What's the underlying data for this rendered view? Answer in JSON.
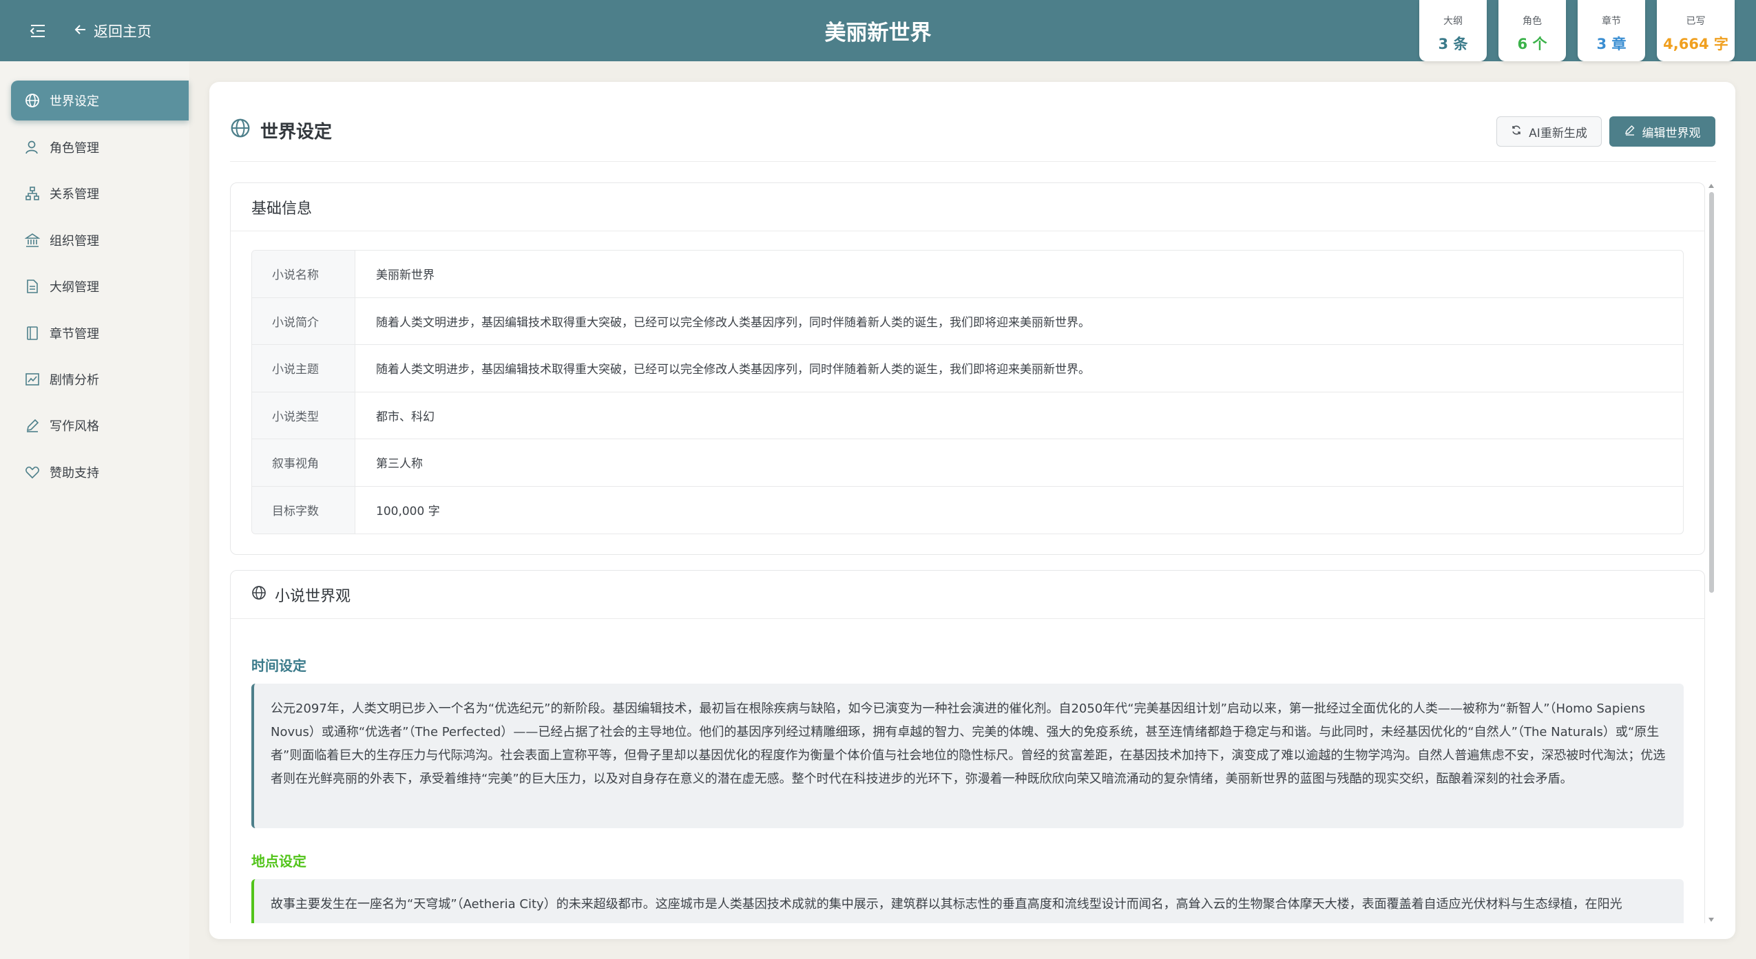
{
  "header": {
    "title": "美丽新世界",
    "back_label": "返回主页",
    "stats": [
      {
        "label": "大纲",
        "value": "3 条",
        "color": "#3a7a8a"
      },
      {
        "label": "角色",
        "value": "6 个",
        "color": "#3bb24a"
      },
      {
        "label": "章节",
        "value": "3 章",
        "color": "#3a8ed2"
      },
      {
        "label": "已写",
        "value": "4,664 字",
        "color": "#f0a020"
      }
    ]
  },
  "sidebar": {
    "items": [
      {
        "label": "世界设定",
        "icon": "globe-icon",
        "active": true
      },
      {
        "label": "角色管理",
        "icon": "user-icon"
      },
      {
        "label": "关系管理",
        "icon": "relation-icon"
      },
      {
        "label": "组织管理",
        "icon": "bank-icon"
      },
      {
        "label": "大纲管理",
        "icon": "file-icon"
      },
      {
        "label": "章节管理",
        "icon": "book-icon"
      },
      {
        "label": "剧情分析",
        "icon": "chart-icon"
      },
      {
        "label": "写作风格",
        "icon": "pen-icon"
      },
      {
        "label": "赞助支持",
        "icon": "heart-icon"
      }
    ]
  },
  "main": {
    "title": "世界设定",
    "regen_label": "AI重新生成",
    "edit_label": "编辑世界观",
    "basic_info": {
      "title": "基础信息",
      "rows": [
        {
          "key": "小说名称",
          "value": "美丽新世界"
        },
        {
          "key": "小说简介",
          "value": "随着人类文明进步，基因编辑技术取得重大突破，已经可以完全修改人类基因序列，同时伴随着新人类的诞生，我们即将迎来美丽新世界。"
        },
        {
          "key": "小说主题",
          "value": "随着人类文明进步，基因编辑技术取得重大突破，已经可以完全修改人类基因序列，同时伴随着新人类的诞生，我们即将迎来美丽新世界。"
        },
        {
          "key": "小说类型",
          "value": "都市、科幻"
        },
        {
          "key": "叙事视角",
          "value": "第三人称"
        },
        {
          "key": "目标字数",
          "value": "100,000 字"
        }
      ]
    },
    "worldview": {
      "title": "小说世界观",
      "time_heading": "时间设定",
      "time_color": "#3a7a8a",
      "time_text": "公元2097年，人类文明已步入一个名为“优选纪元”的新阶段。基因编辑技术，最初旨在根除疾病与缺陷，如今已演变为一种社会演进的催化剂。自2050年代“完美基因组计划”启动以来，第一批经过全面优化的人类——被称为“新智人”（Homo Sapiens Novus）或通称“优选者”（The Perfected）——已经占据了社会的主导地位。他们的基因序列经过精雕细琢，拥有卓越的智力、完美的体魄、强大的免疫系统，甚至连情绪都趋于稳定与和谐。与此同时，未经基因优化的“自然人”（The Naturals）或“原生者”则面临着巨大的生存压力与代际鸿沟。社会表面上宣称平等，但骨子里却以基因优化的程度作为衡量个体价值与社会地位的隐性标尺。曾经的贫富差距，在基因技术加持下，演变成了难以逾越的生物学鸿沟。自然人普遍焦虑不安，深恐被时代淘汰；优选者则在光鲜亮丽的外表下，承受着维持“完美”的巨大压力，以及对自身存在意义的潜在虚无感。整个时代在科技进步的光环下，弥漫着一种既欣欣向荣又暗流涌动的复杂情绪，美丽新世界的蓝图与残酷的现实交织，酝酿着深刻的社会矛盾。",
      "place_heading": "地点设定",
      "place_color": "#52c41a",
      "place_text": "故事主要发生在一座名为“天穹城”（Aetheria City）的未来超级都市。这座城市是人类基因技术成就的集中展示，建筑群以其标志性的垂直高度和流线型设计而闻名，高耸入云的生物聚合体摩天大楼，表面覆盖着自适应光伏材料与生态绿植，在阳光"
    }
  }
}
